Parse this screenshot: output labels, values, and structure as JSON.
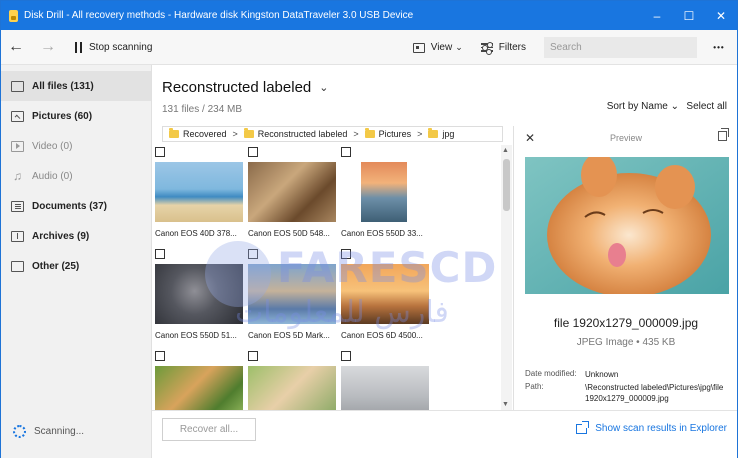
{
  "window": {
    "title": "Disk Drill - All recovery methods - Hardware disk Kingston DataTraveler 3.0 USB Device",
    "controls": {
      "minimize": "–",
      "maximize": "☐",
      "close": "✕"
    }
  },
  "toolbar": {
    "back_glyph": "←",
    "forward_glyph": "→",
    "stop_label": "Stop scanning",
    "view_label": "View",
    "view_chevron": "⌄",
    "filters_label": "Filters",
    "search_placeholder": "Search",
    "more_glyph": "•••"
  },
  "sidebar": {
    "items": [
      {
        "label": "All files (131)",
        "icon": "file-icon",
        "state": "active"
      },
      {
        "label": "Pictures (60)",
        "icon": "picture-icon",
        "state": "bold"
      },
      {
        "label": "Video (0)",
        "icon": "video-icon",
        "state": "muted"
      },
      {
        "label": "Audio (0)",
        "icon": "music-note-icon",
        "state": "muted"
      },
      {
        "label": "Documents (37)",
        "icon": "document-icon",
        "state": "bold"
      },
      {
        "label": "Archives (9)",
        "icon": "archive-icon",
        "state": "bold"
      },
      {
        "label": "Other (25)",
        "icon": "file-icon",
        "state": "bold"
      }
    ],
    "scanning_label": "Scanning..."
  },
  "main": {
    "heading": "Reconstructed labeled",
    "heading_chevron": "⌄",
    "summary": "131 files / 234 MB",
    "sort_label": "Sort by Name ⌄",
    "select_all_label": "Select all",
    "breadcrumb": [
      "Recovered",
      "Reconstructed labeled",
      "Pictures",
      "jpg"
    ],
    "files": [
      {
        "caption": "Canon EOS 40D 378...",
        "palette": "beach"
      },
      {
        "caption": "Canon EOS 50D 548...",
        "palette": "sepia"
      },
      {
        "caption": "Canon EOS 550D 33...",
        "palette": "sunset"
      },
      {
        "caption": "Canon EOS 550D 51...",
        "palette": "monkey"
      },
      {
        "caption": "Canon EOS 5D Mark...",
        "palette": "family"
      },
      {
        "caption": "Canon EOS 6D 4500...",
        "palette": "dusk"
      },
      {
        "caption": "",
        "palette": "kids"
      },
      {
        "caption": "",
        "palette": "girls"
      },
      {
        "caption": "",
        "palette": "gray"
      }
    ],
    "recover_label": "Recover all...",
    "explorer_label": "Show scan results in Explorer"
  },
  "preview": {
    "title": "Preview",
    "close_glyph": "✕",
    "filename": "file 1920x1279_000009.jpg",
    "meta": "JPEG Image • 435 KB",
    "date_key": "Date modified:",
    "date_value": "Unknown",
    "path_key": "Path:",
    "path_value": "\\Reconstructed labeled\\Pictures\\jpg\\file 1920x1279_000009.jpg"
  },
  "watermark": {
    "latin": "FARESCD",
    "arabic": "فارس للمعلومات"
  },
  "colors": {
    "accent": "#1976e0",
    "folder": "#f3c947",
    "sidebar_bg": "#f1f1f1"
  }
}
